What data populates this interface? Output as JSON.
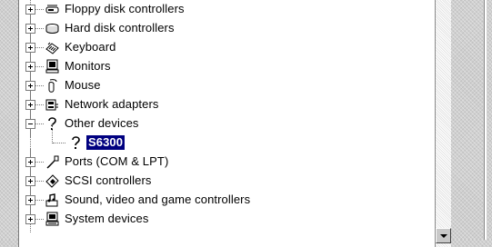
{
  "tree": {
    "items": [
      {
        "label": "Floppy disk controllers",
        "icon": "floppy-controller-icon",
        "expander": "plus"
      },
      {
        "label": "Hard disk controllers",
        "icon": "hard-disk-controller-icon",
        "expander": "plus"
      },
      {
        "label": "Keyboard",
        "icon": "keyboard-icon",
        "expander": "plus"
      },
      {
        "label": "Monitors",
        "icon": "monitor-icon",
        "expander": "plus"
      },
      {
        "label": "Mouse",
        "icon": "mouse-icon",
        "expander": "plus"
      },
      {
        "label": "Network adapters",
        "icon": "network-adapter-icon",
        "expander": "plus"
      },
      {
        "label": "Other devices",
        "icon": "question-mark-icon",
        "expander": "minus",
        "children": [
          {
            "label": "S6300",
            "icon": "question-mark-icon",
            "selected": true
          }
        ]
      },
      {
        "label": "Ports (COM & LPT)",
        "icon": "port-icon",
        "expander": "plus"
      },
      {
        "label": "SCSI controllers",
        "icon": "scsi-controller-icon",
        "expander": "plus"
      },
      {
        "label": "Sound, video and game controllers",
        "icon": "sound-video-game-icon",
        "expander": "plus"
      },
      {
        "label": "System devices",
        "icon": "system-devices-icon",
        "expander": "plus"
      }
    ]
  },
  "colors": {
    "selection_background": "#000080",
    "selection_text": "#ffffff",
    "panel_background": "#ffffff"
  }
}
